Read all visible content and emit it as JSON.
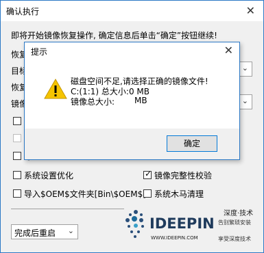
{
  "window": {
    "title": "确认执行",
    "close_glyph": "✕"
  },
  "main": {
    "instruction": "即将开始镜像恢复操作, 确定信息后单击“确定”按钮继续!",
    "row_restore": "恢复",
    "row_target": "目标",
    "row_restore2": "恢复",
    "row_image": "镜像",
    "cb1_partial": "I",
    "cb2_partial": "自",
    "cb3_partial": "导"
  },
  "options": {
    "system_optimize": "系统设置优化",
    "image_verify": "镜像完整性校验",
    "import_oem": "导入$OEM$文件夹[Bin\\$OEM$]",
    "trojan_clean": "系统木马清理"
  },
  "after_action": {
    "selected": "完成后重启"
  },
  "dialog": {
    "title": "提示",
    "close_glyph": "✕",
    "line1": "磁盘空间不足,请选择正确的镜像文件!",
    "line2": "C:(1:1) 总大小:0 MB",
    "line3_label": "镜像总大小:",
    "line3_unit": "MB",
    "ok_label": "确定",
    "icon": "warning-icon"
  },
  "watermark": {
    "brand_cn": "深度·技术",
    "brand_en": "IDEEPIN",
    "url": "WWW.IDEEPIN.COM",
    "slogan1": "告别繁琐安装",
    "slogan2": "享受深度技术"
  }
}
